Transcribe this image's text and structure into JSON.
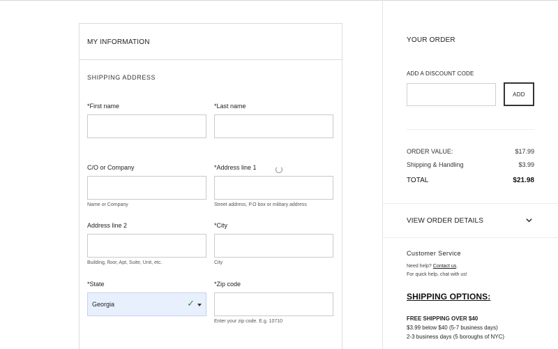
{
  "form": {
    "title": "MY INFORMATION",
    "section": "SHIPPING ADDRESS",
    "fields": {
      "first_name": {
        "label": "*First name",
        "value": ""
      },
      "last_name": {
        "label": "*Last name",
        "value": ""
      },
      "company": {
        "label": "C/O or Company",
        "value": "",
        "hint": "Name or Company"
      },
      "address1": {
        "label": "*Address line 1",
        "value": "",
        "hint": "Street address, P.O box or military address"
      },
      "address2": {
        "label": "Address line 2",
        "value": "",
        "hint": "Building, floor, Apt, Suite, Unit, etc."
      },
      "city": {
        "label": "*City",
        "value": "",
        "hint": "City"
      },
      "state": {
        "label": "*State",
        "value": "Georgia"
      },
      "zip": {
        "label": "*Zip code",
        "value": "",
        "hint": "Enter your zip code. E.g. 10710"
      }
    }
  },
  "order": {
    "title": "YOUR ORDER",
    "discount_label": "ADD A DISCOUNT CODE",
    "discount_value": "",
    "add_label": "ADD",
    "rows": [
      {
        "label": "ORDER VALUE:",
        "value": "$17.99"
      },
      {
        "label": "Shipping & Handling",
        "value": "$3.99"
      }
    ],
    "total": {
      "label": "TOTAL",
      "value": "$21.98"
    },
    "details_label": "VIEW ORDER DETAILS"
  },
  "customer_service": {
    "title": "Customer Service",
    "need_help": "Need help?",
    "contact_link": "Contact us",
    "period": ".",
    "quick_help": "For quick help, chat with us!"
  },
  "shipping": {
    "title": "SHIPPING OPTIONS:",
    "free": "FREE SHIPPING OVER $40",
    "line1": "$3.99 below $40 (5-7 business days)",
    "line2": "2-3 business days (5 boroughs of NYC)"
  },
  "icons": {
    "state_valid": "check-icon",
    "state_dropdown": "caret-down-icon",
    "details_toggle": "chevron-down-icon",
    "loading": "spinner-icon"
  },
  "colors": {
    "autofill_bg": "#e8f0fe",
    "valid_check": "#2e8b3e"
  }
}
